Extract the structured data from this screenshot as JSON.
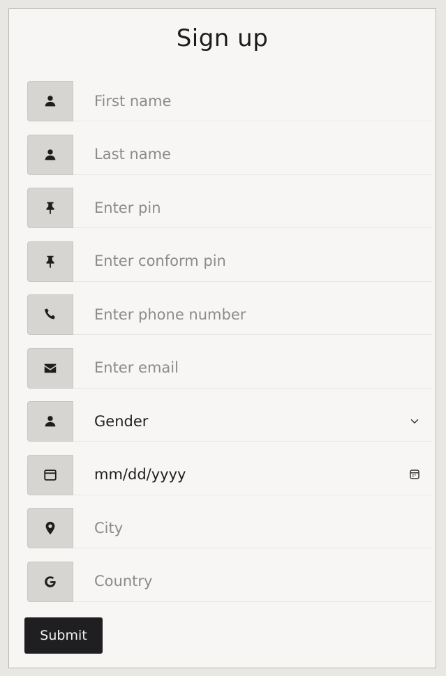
{
  "title": "Sign up",
  "fields": [
    {
      "icon": "user-icon",
      "placeholder": "First name"
    },
    {
      "icon": "user-icon",
      "placeholder": "Last name"
    },
    {
      "icon": "pin-icon",
      "placeholder": "Enter pin"
    },
    {
      "icon": "pin-icon",
      "placeholder": "Enter conform pin"
    },
    {
      "icon": "phone-icon",
      "placeholder": "Enter phone number"
    },
    {
      "icon": "envelope-icon",
      "placeholder": "Enter email"
    },
    {
      "icon": "user-icon",
      "value": "Gender",
      "trailing_icon": "chevron-down-icon"
    },
    {
      "icon": "calendar-icon",
      "value": "mm/dd/yyyy",
      "trailing_icon": "calendar-picker-icon"
    },
    {
      "icon": "location-marker-icon",
      "placeholder": "City"
    },
    {
      "icon": "g-letter-icon",
      "placeholder": "Country"
    }
  ],
  "submit_label": "Submit",
  "colors": {
    "button_bg": "#1f1f22",
    "icon_box_bg": "#d6d5d2",
    "placeholder": "#8c8b88"
  }
}
